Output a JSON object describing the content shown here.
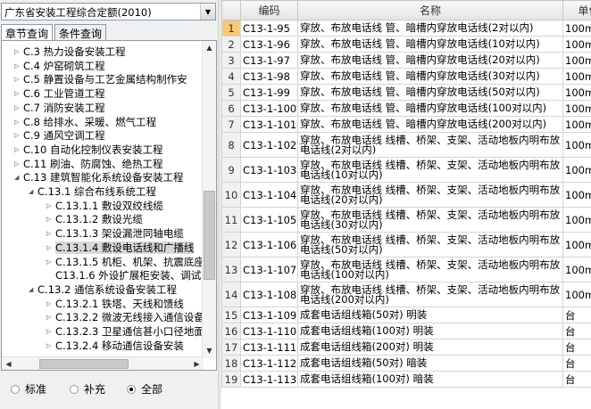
{
  "dropdown": {
    "value": "广东省安装工程综合定额(2010)"
  },
  "tabs": [
    "章节查询",
    "条件查询"
  ],
  "tree": [
    {
      "label": "C.3 热力设备安装工程",
      "level": 0,
      "expander": "collapsed"
    },
    {
      "label": "C.4 炉窑砌筑工程",
      "level": 0,
      "expander": "collapsed"
    },
    {
      "label": "C.5 静置设备与工艺金属结构制作安",
      "level": 0,
      "expander": "collapsed"
    },
    {
      "label": "C.6 工业管道工程",
      "level": 0,
      "expander": "collapsed"
    },
    {
      "label": "C.7 消防安装工程",
      "level": 0,
      "expander": "collapsed"
    },
    {
      "label": "C.8 给排水、采暖、燃气工程",
      "level": 0,
      "expander": "collapsed"
    },
    {
      "label": "C.9 通风空调工程",
      "level": 0,
      "expander": "collapsed"
    },
    {
      "label": "C.10 自动化控制仪表安装工程",
      "level": 0,
      "expander": "collapsed"
    },
    {
      "label": "C.11 刷油、防腐蚀、绝热工程",
      "level": 0,
      "expander": "collapsed"
    },
    {
      "label": "C.13 建筑智能化系统设备安装工程",
      "level": 0,
      "expander": "expanded"
    },
    {
      "label": "C.13.1 综合布线系统工程",
      "level": 1,
      "expander": "expanded"
    },
    {
      "label": "C.13.1.1 敷设双绞线缆",
      "level": 2,
      "expander": "collapsed"
    },
    {
      "label": "C.13.1.2 敷设光缆",
      "level": 2,
      "expander": "collapsed"
    },
    {
      "label": "C.13.1.3 架设漏泄同轴电缆",
      "level": 2,
      "expander": "collapsed"
    },
    {
      "label": "C.13.1.4 敷设电话线和广播线",
      "level": 2,
      "expander": "collapsed",
      "highlight": true
    },
    {
      "label": "C.13.1.5 机柜、机架、抗震底座",
      "level": 2,
      "expander": "collapsed"
    },
    {
      "label": "C13.1.6 外设扩展柜安装、调试",
      "level": 2,
      "expander": "none"
    },
    {
      "label": "C.13.2 通信系统设备安装工程",
      "level": 1,
      "expander": "expanded"
    },
    {
      "label": "C.13.2.1 铁塔、天线和馈线",
      "level": 2,
      "expander": "collapsed"
    },
    {
      "label": "C.13.2.2 微波无线接入通信设备",
      "level": 2,
      "expander": "collapsed"
    },
    {
      "label": "C.13.2.3 卫星通信甚小口径地面站",
      "level": 2,
      "expander": "collapsed"
    },
    {
      "label": "C.13.2.4 移动通信设备安装",
      "level": 2,
      "expander": "collapsed"
    }
  ],
  "filter": {
    "options": [
      "标准",
      "补充",
      "全部"
    ],
    "selected": "全部"
  },
  "grid": {
    "columns": [
      "编码",
      "名称",
      "单位"
    ],
    "rows": [
      {
        "n": "1",
        "code": "C13-1-95",
        "name": "穿放、布放电话线 管、暗槽内穿放电话线(2对以内)",
        "unit": "100m",
        "lines": 1,
        "selected": true
      },
      {
        "n": "2",
        "code": "C13-1-96",
        "name": "穿放、布放电话线 管、暗槽内穿放电话线(10对以内)",
        "unit": "100m",
        "lines": 1
      },
      {
        "n": "3",
        "code": "C13-1-97",
        "name": "穿放、布放电话线 管、暗槽内穿放电话线(20对以内)",
        "unit": "100m",
        "lines": 1
      },
      {
        "n": "4",
        "code": "C13-1-98",
        "name": "穿放、布放电话线 管、暗槽内穿放电话线(30对以内)",
        "unit": "100m",
        "lines": 1
      },
      {
        "n": "5",
        "code": "C13-1-99",
        "name": "穿放、布放电话线 管、暗槽内穿放电话线(50对以内)",
        "unit": "100m",
        "lines": 1
      },
      {
        "n": "6",
        "code": "C13-1-100",
        "name": "穿放、布放电话线 管、暗槽内穿放电话线(100对以内)",
        "unit": "100m",
        "lines": 1
      },
      {
        "n": "7",
        "code": "C13-1-101",
        "name": "穿放、布放电话线 管、暗槽内穿放电话线(200对以内)",
        "unit": "100m",
        "lines": 1
      },
      {
        "n": "8",
        "code": "C13-1-102",
        "name": "穿放、布放电话线 线槽、桥架、支架、活动地板内明布放电话线(2对以内)",
        "unit": "100m",
        "lines": 2
      },
      {
        "n": "9",
        "code": "C13-1-103",
        "name": "穿放、布放电话线 线槽、桥架、支架、活动地板内明布放电话线(10对以内)",
        "unit": "100m",
        "lines": 2
      },
      {
        "n": "10",
        "code": "C13-1-104",
        "name": "穿放、布放电话线 线槽、桥架、支架、活动地板内明布放电话线(20对以内)",
        "unit": "100m",
        "lines": 2
      },
      {
        "n": "11",
        "code": "C13-1-105",
        "name": "穿放、布放电话线 线槽、桥架、支架、活动地板内明布放电话线(30对以内)",
        "unit": "100m",
        "lines": 2
      },
      {
        "n": "12",
        "code": "C13-1-106",
        "name": "穿放、布放电话线 线槽、桥架、支架、活动地板内明布放电话线(50对以内)",
        "unit": "100m",
        "lines": 2
      },
      {
        "n": "13",
        "code": "C13-1-107",
        "name": "穿放、布放电话线 线槽、桥架、支架、活动地板内明布放电话线(100对以内)",
        "unit": "100m",
        "lines": 2
      },
      {
        "n": "14",
        "code": "C13-1-108",
        "name": "穿放、布放电话线 线槽、桥架、支架、活动地板内明布放电话线(200对以内)",
        "unit": "100m",
        "lines": 2
      },
      {
        "n": "15",
        "code": "C13-1-109",
        "name": "成套电话组线箱(50对) 明装",
        "unit": "台",
        "lines": 1
      },
      {
        "n": "16",
        "code": "C13-1-110",
        "name": "成套电话组线箱(100对) 明装",
        "unit": "台",
        "lines": 1
      },
      {
        "n": "17",
        "code": "C13-1-111",
        "name": "成套电话组线箱(200对) 明装",
        "unit": "台",
        "lines": 1
      },
      {
        "n": "18",
        "code": "C13-1-112",
        "name": "成套电话组线箱(50对) 暗装",
        "unit": "台",
        "lines": 1
      },
      {
        "n": "19",
        "code": "C13-1-113",
        "name": "成套电话组线箱(100对) 暗装",
        "unit": "台",
        "lines": 1
      }
    ]
  }
}
